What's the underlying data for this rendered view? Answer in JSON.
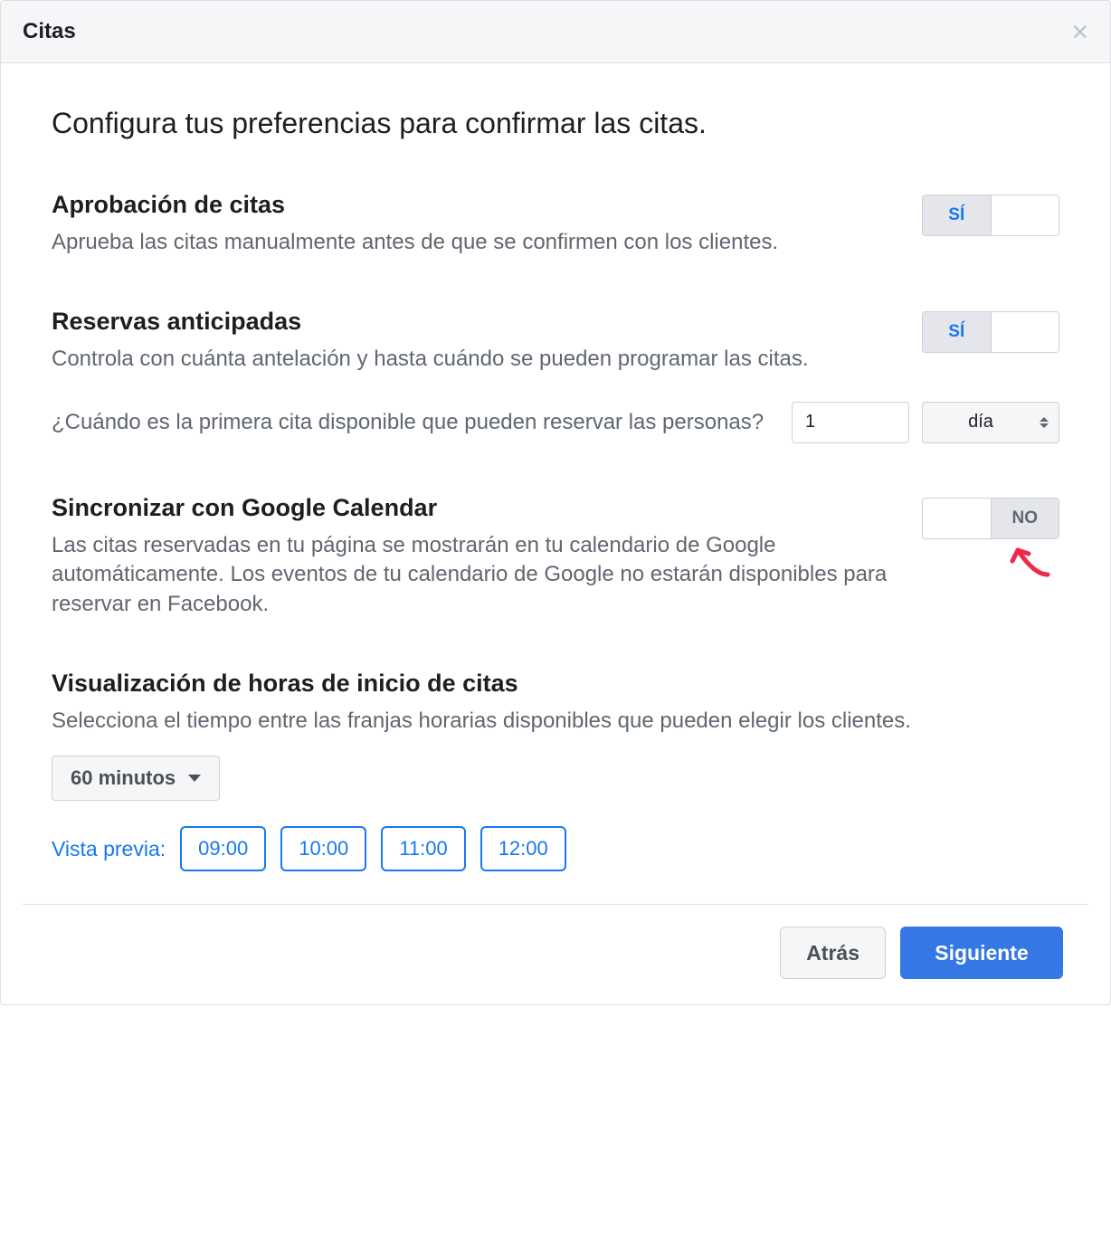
{
  "header": {
    "title": "Citas"
  },
  "page_title": "Configura tus preferencias para confirmar las citas.",
  "approval": {
    "heading": "Aprobación de citas",
    "desc": "Aprueba las citas manualmente antes de que se confirmen con los clientes.",
    "toggle_yes": "SÍ"
  },
  "advance": {
    "heading": "Reservas anticipadas",
    "desc": "Controla con cuánta antelación y hasta cuándo se pueden programar las citas.",
    "toggle_yes": "SÍ",
    "question": "¿Cuándo es la primera cita disponible que pueden reservar las personas?",
    "value": "1",
    "unit": "día"
  },
  "google": {
    "heading": "Sincronizar con Google Calendar",
    "desc": "Las citas reservadas en tu página se mostrarán en tu calendario de Google automáticamente. Los eventos de tu calendario de Google no estarán disponibles para reservar en Facebook.",
    "toggle_no": "NO"
  },
  "display": {
    "heading": "Visualización de horas de inicio de citas",
    "desc": "Selecciona el tiempo entre las franjas horarias disponibles que pueden elegir los clientes.",
    "interval": "60 minutos",
    "preview_label": "Vista previa:",
    "times": [
      "09:00",
      "10:00",
      "11:00",
      "12:00"
    ]
  },
  "footer": {
    "back": "Atrás",
    "next": "Siguiente"
  }
}
